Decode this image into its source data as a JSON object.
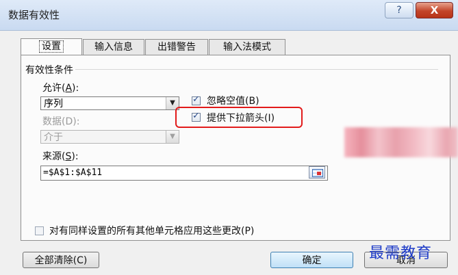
{
  "window": {
    "title": "数据有效性",
    "help_glyph": "?",
    "close_glyph": "X"
  },
  "tabs": [
    {
      "label": "设置",
      "active": true
    },
    {
      "label": "输入信息",
      "active": false
    },
    {
      "label": "出错警告",
      "active": false
    },
    {
      "label": "输入法模式",
      "active": false
    }
  ],
  "settings": {
    "section_title": "有效性条件",
    "allow_label": "允许(",
    "allow_key": "A",
    "allow_label_end": "):",
    "allow_value": "序列",
    "data_label": "数据(D):",
    "data_value": "介于",
    "ignore_blank_label": "忽略空值(B)",
    "ignore_blank_checked": true,
    "dropdown_label": "提供下拉箭头(I)",
    "dropdown_checked": true,
    "source_label": "来源(",
    "source_key": "S",
    "source_label_end": "):",
    "source_value": "=$A$1:$A$11",
    "apply_all_label": "对有同样设置的所有其他单元格应用这些更改(P)",
    "apply_all_checked": false
  },
  "buttons": {
    "clear_all": "全部清除(C)",
    "ok": "确定",
    "cancel_partial": "取消"
  },
  "watermark": "最需教育",
  "colors": {
    "highlight": "#e21a1a",
    "watermark": "#1e3bc8"
  }
}
